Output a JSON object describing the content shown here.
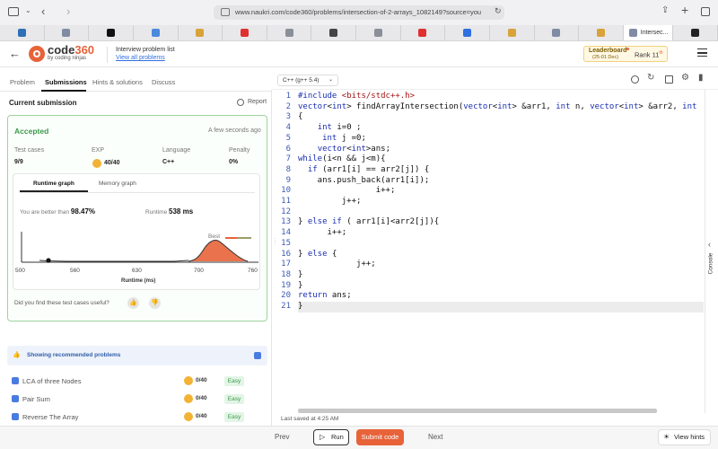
{
  "browser": {
    "url": "www.naukri.com/code360/problems/intersection-of-2-arrays_1082149?source=you",
    "tabs": [
      {
        "icon": "in",
        "color": "#2f6fb6"
      },
      {
        "icon": "D",
        "color": "#7f8ca3"
      },
      {
        "icon": "X",
        "color": "#111111"
      },
      {
        "icon": "cloud",
        "color": "#4a89dc"
      },
      {
        "icon": "leaf",
        "color": "#d8a33a"
      },
      {
        "icon": "yt",
        "color": "#e02f2f"
      },
      {
        "icon": "1",
        "color": "#8a8f99"
      },
      {
        "icon": "W",
        "color": "#444444"
      },
      {
        "icon": "1",
        "color": "#8a8f99"
      },
      {
        "icon": "yt",
        "color": "#e02f2f"
      },
      {
        "icon": "b",
        "color": "#2f6fe0"
      },
      {
        "icon": "leaf",
        "color": "#d8a33a"
      },
      {
        "icon": "N",
        "color": "#7f8ca3"
      },
      {
        "icon": "leaf",
        "color": "#d8a33a"
      },
      {
        "icon": "N",
        "color": "#7f8ca3",
        "label": "Intersec...",
        "active": true
      },
      {
        "icon": "gpt",
        "color": "#222222"
      }
    ]
  },
  "site": {
    "brand": "code",
    "brand_num": "360",
    "brand_sub": "by coding ninjas",
    "crumb": "Interview problem list",
    "crumb_link": "View all problems",
    "leaderboard_label": "Leaderboard",
    "leaderboard_date": "(25-01 Dec)",
    "rank_label": "Rank",
    "rank_value": "11",
    "rank_suffix": "th"
  },
  "tabs": {
    "problem": "Problem",
    "submissions": "Submissions",
    "hints": "Hints & solutions",
    "discuss": "Discuss"
  },
  "editor_lang": "C++ (g++ 5.4)",
  "submission": {
    "heading": "Current submission",
    "report": "Report",
    "status": "Accepted",
    "time": "A few seconds ago",
    "labels": {
      "tests": "Test cases",
      "exp": "EXP",
      "lang": "Language",
      "penalty": "Penalty"
    },
    "tests": "9/9",
    "exp": "40/40",
    "lang": "C++",
    "penalty": "0%",
    "graph_tabs": {
      "runtime": "Runtime graph",
      "memory": "Memory graph"
    },
    "better_text": "You are better than",
    "better_pct": "98.47%",
    "runtime_label": "Runtime",
    "runtime_value": "538 ms",
    "best_label": "Best",
    "feedback": "Did you find these test cases useful?"
  },
  "chart_data": {
    "type": "area",
    "x_ticks": [
      "500",
      "560",
      "630",
      "700",
      "760"
    ],
    "xlabel": "Runtime (ms)",
    "xlim": [
      500,
      760
    ],
    "marker_x": 530
  },
  "recommended": {
    "header": "Showing recommended problems",
    "items": [
      {
        "title": "LCA of three Nodes",
        "exp": "0/40",
        "level": "Easy"
      },
      {
        "title": "Pair Sum",
        "exp": "0/40",
        "level": "Easy"
      },
      {
        "title": "Reverse The Array",
        "exp": "0/40",
        "level": "Easy"
      }
    ]
  },
  "code_lines": [
    "#include <bits/stdc++.h>",
    "vector<int> findArrayIntersection(vector<int> &arr1, int n, vector<int> &arr2, int",
    "{",
    "    int i=0 ;",
    "     int j =0;",
    "    vector<int>ans;",
    "while(i<n && j<m){",
    "  if (arr1[i] == arr2[j]) {",
    "    ans.push_back(arr1[i]);",
    "                i++;",
    "         j++;",
    "",
    "} else if ( arr1[i]<arr2[j]){",
    "      i++;",
    "",
    "} else {",
    "            j++;",
    "}",
    "}",
    "return ans;",
    "}"
  ],
  "footer": {
    "saved": "Last saved at 4:25 AM",
    "prev": "Prev",
    "run": "Run",
    "submit": "Submit code",
    "next": "Next",
    "hints": "View hints"
  },
  "side_rail": "Console"
}
